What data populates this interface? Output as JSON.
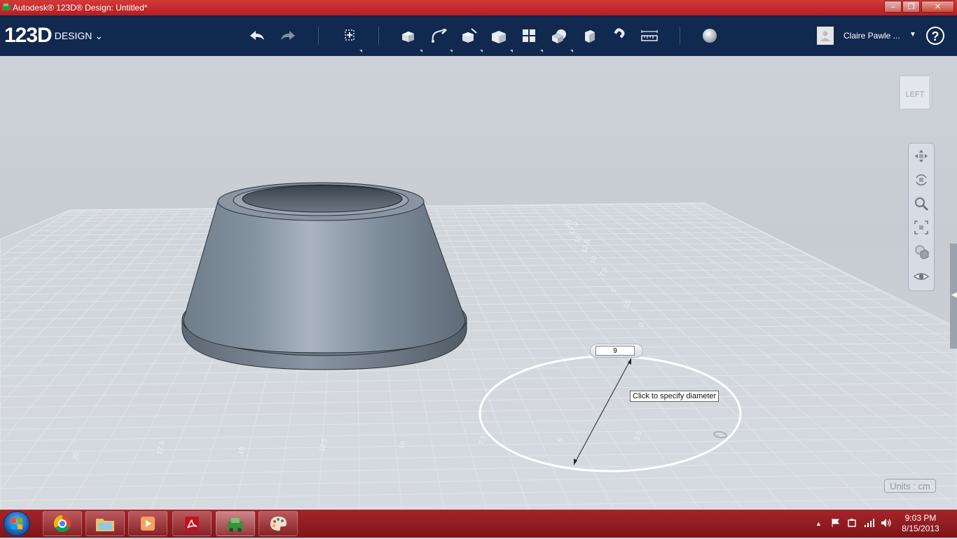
{
  "window": {
    "title": "Autodesk® 123D® Design: Untitled*",
    "controls": [
      "minimize",
      "restore",
      "close"
    ]
  },
  "toolbar": {
    "logo_main": "123D",
    "logo_sub": "DESIGN",
    "tools": [
      "undo",
      "redo",
      "transform",
      "primitives",
      "sketch",
      "construct",
      "modify",
      "pattern",
      "grouping",
      "combine",
      "snap",
      "measure",
      "material"
    ]
  },
  "user": {
    "name": "Claire Pawle ..."
  },
  "help": {
    "label": "?"
  },
  "viewcube": {
    "face_label": "LEFT"
  },
  "nav_tools": [
    "pan",
    "orbit",
    "zoom",
    "fit",
    "views",
    "visibility"
  ],
  "sketch": {
    "diameter_value": "9",
    "tooltip": "Click to specify diameter"
  },
  "grid_labels": [
    "20",
    "17.5",
    "15",
    "12.5",
    "10",
    "7.5",
    "5",
    "2.5",
    "0",
    "2.5",
    "5",
    "7.5",
    "10",
    "12.5",
    "15",
    "17.5",
    "20"
  ],
  "units": {
    "label": "Units : cm"
  },
  "taskbar": {
    "apps": [
      "chrome",
      "file-explorer",
      "media-player",
      "acrobat",
      "123d-design",
      "paint"
    ],
    "time": "9:03 PM",
    "date": "8/15/2013"
  },
  "colors": {
    "title_bar": "#c0282c",
    "toolbar": "#11284f",
    "viewport": "#c9ced4",
    "taskbar": "#94191e"
  }
}
